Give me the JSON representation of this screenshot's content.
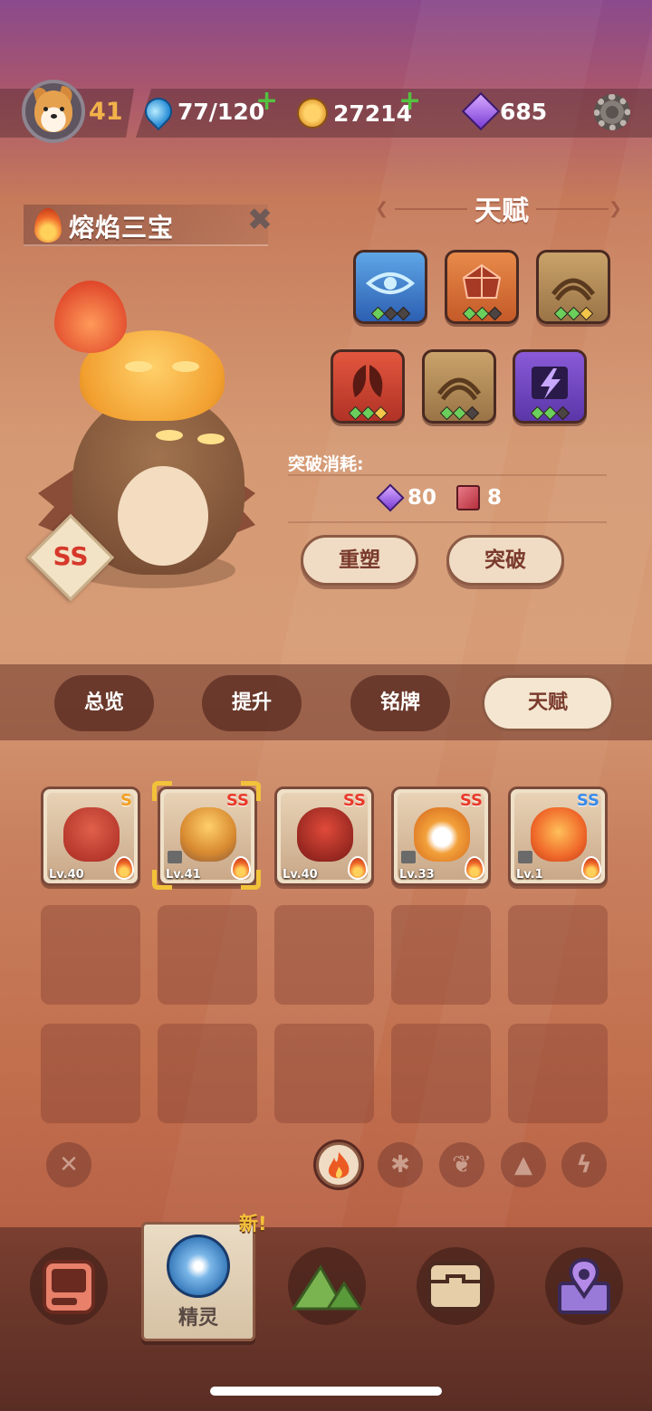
{
  "player": {
    "level": "41",
    "energy": "77/120",
    "gold": "27214",
    "gems": "685"
  },
  "creature": {
    "name": "熔焰三宝",
    "grade": "SS"
  },
  "talent": {
    "title": "天赋",
    "cost_label": "突破消耗:",
    "cost_gems": "80",
    "cost_books": "8",
    "reshape_button": "重塑",
    "breakthrough_button": "突破",
    "tiles": [
      {
        "name": "eye",
        "color": "#2c5fb2",
        "pips": [
          "on",
          "off",
          "off"
        ]
      },
      {
        "name": "crystal",
        "color": "#c45a28",
        "pips": [
          "on",
          "on",
          "off"
        ]
      },
      {
        "name": "claw",
        "color": "#9a7446",
        "pips": [
          "on",
          "on",
          "gold"
        ]
      },
      {
        "name": "shield-split",
        "color": "#b13226",
        "pips": [
          "on",
          "on",
          "gold"
        ]
      },
      {
        "name": "claw",
        "color": "#9a7446",
        "pips": [
          "on",
          "on",
          "off"
        ]
      },
      {
        "name": "lightning",
        "color": "#5a36a8",
        "pips": [
          "on",
          "on",
          "off"
        ]
      }
    ]
  },
  "tabs": {
    "overview": "总览",
    "upgrade": "提升",
    "plate": "铭牌",
    "talent": "天赋"
  },
  "roster": [
    {
      "grade": "S",
      "level": "Lv.40"
    },
    {
      "grade": "SS",
      "level": "Lv.41"
    },
    {
      "grade": "SS",
      "level": "Lv.40"
    },
    {
      "grade": "SS",
      "level": "Lv.33"
    },
    {
      "grade": "SS",
      "level": "Lv.1"
    }
  ],
  "nav": {
    "spirit_label": "精灵",
    "new_badge": "新!"
  },
  "colors": {
    "accent_gold": "#f2b24a",
    "plus_green": "#53c23f",
    "grade_red": "#e83a2a"
  }
}
